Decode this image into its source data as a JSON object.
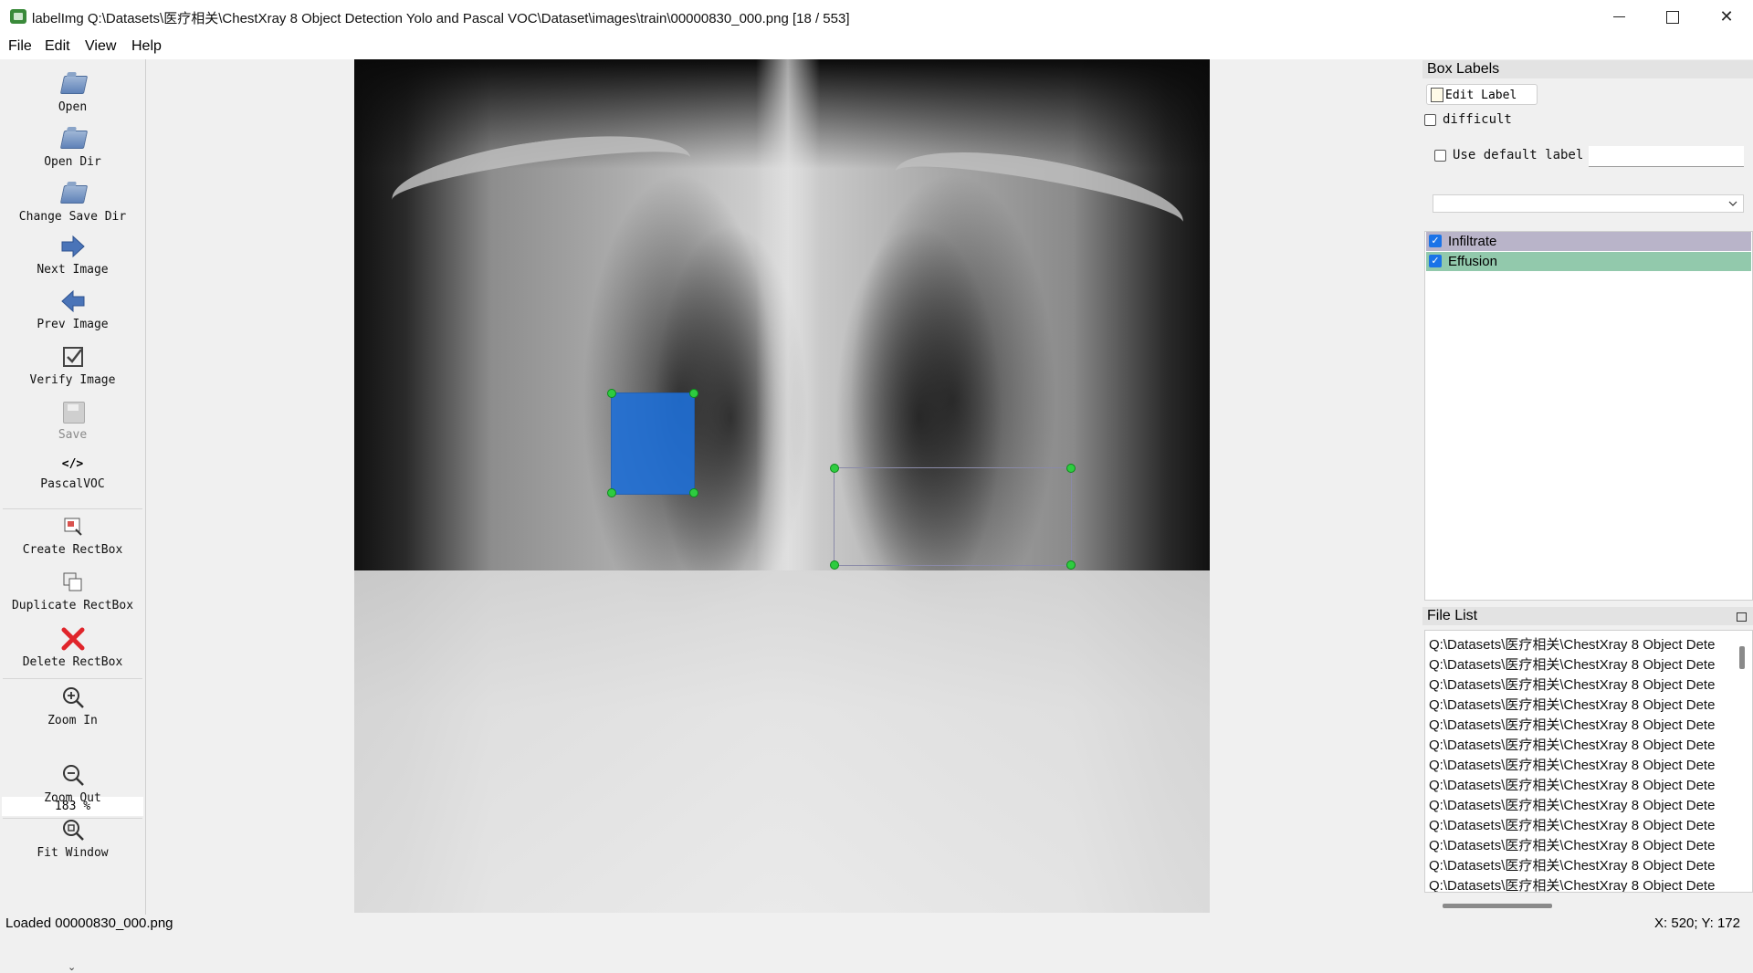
{
  "window": {
    "title": "labelImg Q:\\Datasets\\医疗相关\\ChestXray 8 Object Detection Yolo and Pascal VOC\\Dataset\\images\\train\\00000830_000.png [18 / 553]",
    "minimize_symbol": "—",
    "close_symbol": "✕"
  },
  "menu": [
    "File",
    "Edit",
    "View",
    "Help"
  ],
  "toolbar": {
    "open": "Open",
    "open_dir": "Open Dir",
    "change_save_dir": "Change Save Dir",
    "next_image": "Next Image",
    "prev_image": "Prev Image",
    "verify_image": "Verify Image",
    "save": "Save",
    "format_icon": "</>",
    "format": "PascalVOC",
    "create_rectbox": "Create RectBox",
    "duplicate_rectbox": "Duplicate RectBox",
    "delete_rectbox": "Delete RectBox",
    "zoom_in": "Zoom In",
    "zoom_value": "183 %",
    "zoom_out": "Zoom Out",
    "fit_window": "Fit Window",
    "more": "⌄"
  },
  "box_labels": {
    "title": "Box Labels",
    "edit_label": "Edit Label",
    "difficult": "difficult",
    "use_default_label": "Use default label",
    "default_label_value": "",
    "labels": [
      {
        "name": "Infiltrate",
        "checked": true,
        "color": "#b9b4c9"
      },
      {
        "name": "Effusion",
        "checked": true,
        "color": "#92c9ac"
      }
    ]
  },
  "file_list": {
    "title": "File List",
    "items": [
      "Q:\\Datasets\\医疗相关\\ChestXray 8 Object Dete",
      "Q:\\Datasets\\医疗相关\\ChestXray 8 Object Dete",
      "Q:\\Datasets\\医疗相关\\ChestXray 8 Object Dete",
      "Q:\\Datasets\\医疗相关\\ChestXray 8 Object Dete",
      "Q:\\Datasets\\医疗相关\\ChestXray 8 Object Dete",
      "Q:\\Datasets\\医疗相关\\ChestXray 8 Object Dete",
      "Q:\\Datasets\\医疗相关\\ChestXray 8 Object Dete",
      "Q:\\Datasets\\医疗相关\\ChestXray 8 Object Dete",
      "Q:\\Datasets\\医疗相关\\ChestXray 8 Object Dete",
      "Q:\\Datasets\\医疗相关\\ChestXray 8 Object Dete",
      "Q:\\Datasets\\医疗相关\\ChestXray 8 Object Dete",
      "Q:\\Datasets\\医疗相关\\ChestXray 8 Object Dete",
      "Q:\\Datasets\\医疗相关\\ChestXray 8 Object Dete"
    ]
  },
  "status": {
    "message": "Loaded 00000830_000.png",
    "coords": "X: 520; Y: 172"
  },
  "colors": {
    "selected_box": "#1f6fd6",
    "handle": "#2ecc40",
    "checkbox": "#1a73e8"
  }
}
